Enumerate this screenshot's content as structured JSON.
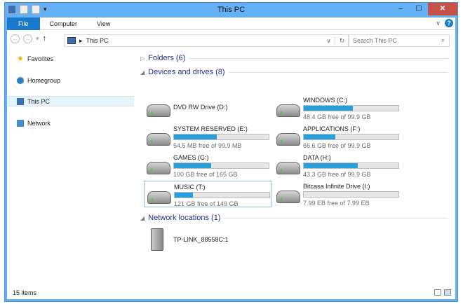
{
  "window": {
    "title": "This PC",
    "minimize": "‒",
    "maximize": "☐",
    "close": "✕"
  },
  "ribbon": {
    "tabs": [
      "File",
      "Computer",
      "View"
    ],
    "expand": "∨",
    "help": "?"
  },
  "nav": {
    "back": "←",
    "forward": "→",
    "recent": "▾",
    "up": "↑",
    "breadcrumb_sep": "▸",
    "location": "This PC",
    "dropdown": "∨",
    "refresh": "↻",
    "search_placeholder": "Search This PC",
    "search_icon": "⌕"
  },
  "sidebar": {
    "items": [
      {
        "label": "Favorites",
        "icon": "star-icon"
      },
      {
        "label": "Homegroup",
        "icon": "homegroup-icon"
      },
      {
        "label": "This PC",
        "icon": "computer-icon",
        "selected": true
      },
      {
        "label": "Network",
        "icon": "network-icon"
      }
    ]
  },
  "groups": {
    "folders": "Folders (6)",
    "devices": "Devices and drives (8)",
    "network": "Network locations (1)"
  },
  "drives": [
    {
      "name": "DVD RW Drive (D:)",
      "type": "dvd"
    },
    {
      "name": "WINDOWS (C:)",
      "free": "48.4 GB free of 99.9 GB",
      "used_pct": 52
    },
    {
      "name": "SYSTEM RESERVED (E:)",
      "free": "54.5 MB free of 99.9 MB",
      "used_pct": 45
    },
    {
      "name": "APPLICATIONS (F:)",
      "free": "66.6 GB free of 99.9 GB",
      "used_pct": 33
    },
    {
      "name": "GAMES (G:)",
      "free": "100 GB free of 165 GB",
      "used_pct": 39
    },
    {
      "name": "DATA (H:)",
      "free": "43.3 GB free of 99.9 GB",
      "used_pct": 57
    },
    {
      "name": "MUSIC (T:)",
      "free": "121 GB free of 149 GB",
      "used_pct": 19,
      "selected": true
    },
    {
      "name": "Bitcasa Infinite Drive (I:)",
      "free": "7.99 EB free of 7.99 EB",
      "used_pct": 0
    }
  ],
  "network_locations": [
    {
      "name": "TP-LINK_88558C:1"
    }
  ],
  "status": {
    "items": "15 items"
  },
  "colors": {
    "titlebar": "#64b0f6",
    "accent": "#1979ca",
    "bar_fill": "#26a0da",
    "group_heading": "#1e3287",
    "close": "#c7504a"
  }
}
